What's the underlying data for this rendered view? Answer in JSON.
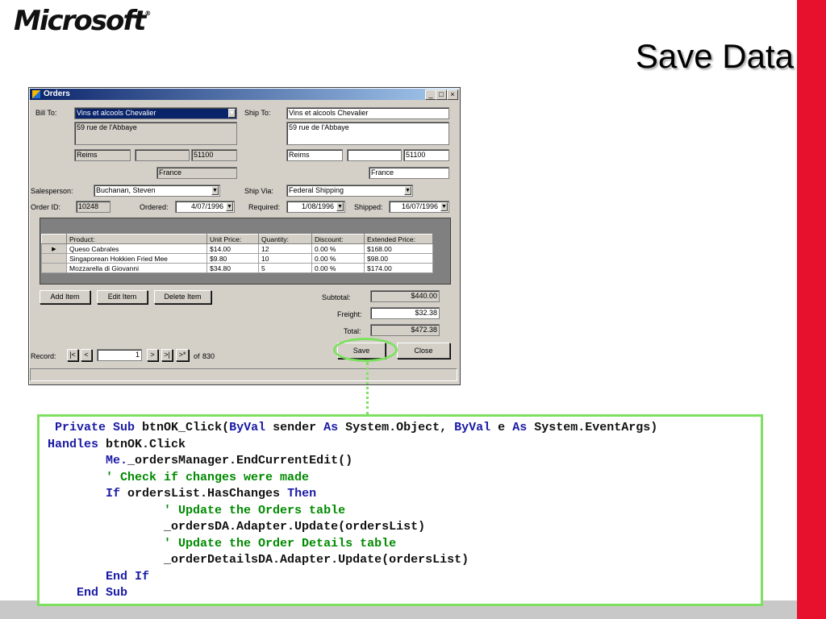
{
  "slide": {
    "logo_text": "Microsoft",
    "logo_mark": "®",
    "title": "Save Data",
    "colors": {
      "accent_red": "#e8112d",
      "highlight_green": "#7ee060",
      "keyword_blue": "#1a1aa6",
      "comment_green": "#008a00"
    }
  },
  "window": {
    "title": "Orders",
    "controls": {
      "minimize": "_",
      "maximize": "□",
      "close": "×"
    },
    "bill_to": {
      "label": "Bill To:",
      "name": "Vins et alcools Chevalier",
      "address": "59 rue de l'Abbaye",
      "city": "Reims",
      "region": "",
      "postal": "51100",
      "country": "France"
    },
    "ship_to": {
      "label": "Ship To:",
      "name": "Vins et alcools Chevalier",
      "address": "59 rue de l'Abbaye",
      "city": "Reims",
      "region": "",
      "postal": "51100",
      "country": "France"
    },
    "salesperson": {
      "label": "Salesperson:",
      "value": "Buchanan, Steven"
    },
    "ship_via": {
      "label": "Ship Via:",
      "value": "Federal Shipping"
    },
    "order_id": {
      "label": "Order ID:",
      "value": "10248"
    },
    "ordered": {
      "label": "Ordered:",
      "value": "4/07/1996"
    },
    "required": {
      "label": "Required:",
      "value": "1/08/1996"
    },
    "shipped": {
      "label": "Shipped:",
      "value": "16/07/1996"
    },
    "grid": {
      "row_marker": "▶",
      "columns": [
        "Product:",
        "Unit Price:",
        "Quantity:",
        "Discount:",
        "Extended Price:"
      ],
      "rows": [
        [
          "Queso Cabrales",
          "$14.00",
          "12",
          "0.00 %",
          "$168.00"
        ],
        [
          "Singaporean Hokkien Fried Mee",
          "$9.80",
          "10",
          "0.00 %",
          "$98.00"
        ],
        [
          "Mozzarella di Giovanni",
          "$34.80",
          "5",
          "0.00 %",
          "$174.00"
        ]
      ]
    },
    "buttons": {
      "add": "Add Item",
      "edit": "Edit Item",
      "delete": "Delete Item",
      "save": "Save",
      "close": "Close"
    },
    "totals": {
      "subtotal_label": "Subtotal:",
      "subtotal": "$440.00",
      "freight_label": "Freight:",
      "freight": "$32.38",
      "total_label": "Total:",
      "total": "$472.38"
    },
    "record_nav": {
      "label": "Record:",
      "first": "|<",
      "prev": "<",
      "position": "1",
      "next": ">",
      "last": ">|",
      "new": ">*",
      "of_label": "of",
      "count": "830"
    },
    "dropdown_glyph": "▼"
  },
  "code": {
    "line1": {
      "kw1": "Private Sub",
      "t1": " btnOK_Click(",
      "kw2": "ByVal",
      "t2": " sender ",
      "kw3": "As",
      "t3": " System.Object, ",
      "kw4": "ByVal",
      "t4": " e ",
      "kw5": "As",
      "t5": " System.EventArgs)"
    },
    "line2": {
      "kw1": "Handles",
      "t1": " btnOK.Click"
    },
    "line3": {
      "kw1": "Me.",
      "t1": "_ordersManager.EndCurrentEdit()"
    },
    "line4": {
      "cm": "' Check if changes were made"
    },
    "line5": {
      "kw1": "If",
      "t1": " ordersList.HasChanges ",
      "kw2": "Then"
    },
    "line6": {
      "cm": "' Update the Orders table"
    },
    "line7": {
      "t1": "_ordersDA.Adapter.Update(ordersList)"
    },
    "line8": {
      "cm": "' Update the Order Details table"
    },
    "line9": {
      "t1": "_orderDetailsDA.Adapter.Update(ordersList)"
    },
    "line10": {
      "kw1": "End If"
    },
    "line11": {
      "kw1": "End Sub"
    }
  }
}
